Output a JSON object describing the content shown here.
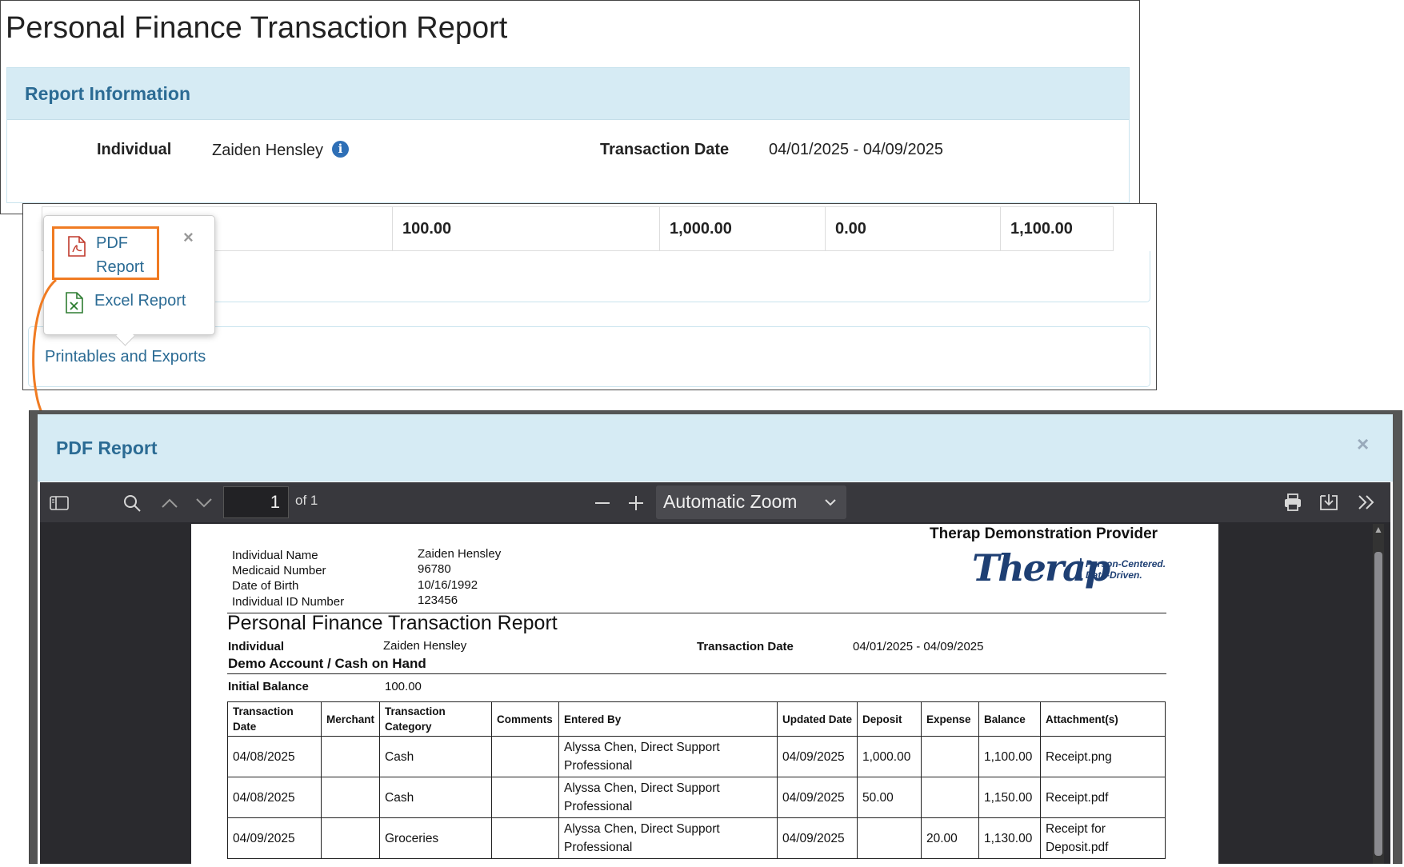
{
  "report": {
    "title": "Personal Finance Transaction Report",
    "section_title": "Report Information",
    "individual_label": "Individual",
    "individual_value": "Zaiden Hensley",
    "info_icon": "i",
    "date_label": "Transaction Date",
    "date_value": "04/01/2025 - 04/09/2025"
  },
  "totals_row": [
    "100.00",
    "1,000.00",
    "0.00",
    "1,100.00"
  ],
  "popover": {
    "pdf_label": "PDF Report",
    "excel_label": "Excel Report",
    "close": "×"
  },
  "printables_link": "Printables and Exports",
  "highlight_color": "#f07b22",
  "dialog": {
    "title": "PDF Report",
    "close": "×"
  },
  "viewer": {
    "page_number": "1",
    "page_of": "of 1",
    "zoom": "Automatic Zoom",
    "icons": [
      "sidebar-toggle-icon",
      "search-icon",
      "chevron-up-icon",
      "chevron-down-icon",
      "zoom-out-icon",
      "zoom-in-icon",
      "print-icon",
      "download-icon",
      "tools-icon"
    ]
  },
  "pdf": {
    "provider": "Therap Demonstration Provider",
    "logo_text": "Therap",
    "tagline": [
      "Person-Centered.",
      "Data-Driven."
    ],
    "demographics": [
      {
        "label": "Individual Name",
        "value": "Zaiden Hensley"
      },
      {
        "label": "Medicaid Number",
        "value": "96780"
      },
      {
        "label": "Date of Birth",
        "value": "10/16/1992"
      },
      {
        "label": "Individual ID Number",
        "value": "123456"
      }
    ],
    "title": "Personal Finance Transaction Report",
    "individual_label": "Individual",
    "individual_value": "Zaiden Hensley",
    "date_label": "Transaction Date",
    "date_value": "04/01/2025 - 04/09/2025",
    "account": "Demo Account / Cash on Hand",
    "initial_balance_label": "Initial Balance",
    "initial_balance_value": "100.00",
    "columns": [
      "Transaction Date",
      "Merchant",
      "Transaction Category",
      "Comments",
      "Entered By",
      "Updated Date",
      "Deposit",
      "Expense",
      "Balance",
      "Attachment(s)"
    ],
    "rows": [
      [
        "04/08/2025",
        "",
        "Cash",
        "",
        "Alyssa Chen, Direct Support Professional",
        "04/09/2025",
        "1,000.00",
        "",
        "1,100.00",
        "Receipt.png"
      ],
      [
        "04/08/2025",
        "",
        "Cash",
        "",
        "Alyssa Chen, Direct Support Professional",
        "04/09/2025",
        "50.00",
        "",
        "1,150.00",
        "Receipt.pdf"
      ],
      [
        "04/09/2025",
        "",
        "Groceries",
        "",
        "Alyssa Chen, Direct Support Professional",
        "04/09/2025",
        "",
        "20.00",
        "1,130.00",
        "Receipt for Deposit.pdf"
      ]
    ]
  }
}
